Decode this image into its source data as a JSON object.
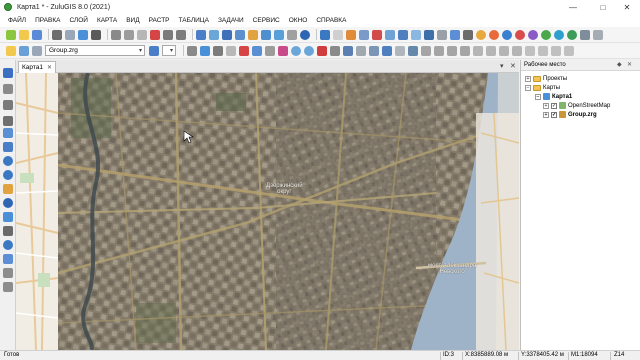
{
  "window": {
    "title": "Карта1 * - ZuluGIS 8.0 (2021)"
  },
  "menu": [
    "ФАЙЛ",
    "ПРАВКА",
    "СЛОЙ",
    "КАРТА",
    "ВИД",
    "РАСТР",
    "ТАБЛИЦА",
    "ЗАДАЧИ",
    "СЕРВИС",
    "ОКНО",
    "СПРАВКА"
  ],
  "toolbar": {
    "layer_combo": "Group.zrg"
  },
  "tabs": [
    {
      "label": "Карта1"
    }
  ],
  "map": {
    "labels": [
      {
        "text": "Дзержинский",
        "sub": "округ"
      },
      {
        "text": "мост Александра",
        "sub": "Невского"
      }
    ]
  },
  "workspace": {
    "title": "Рабочее место",
    "tree": [
      {
        "label": "Проекты"
      },
      {
        "label": "Карты"
      },
      {
        "label": "Карта1"
      },
      {
        "label": "OpenStreetMap"
      },
      {
        "label": "Group.zrg"
      }
    ]
  },
  "status": {
    "ready": "Готов",
    "id": "ID:3",
    "x": "X:8385889.08 м",
    "y": "Y:3378405.42 м",
    "scale": "M1:18094",
    "zoom": "Z14"
  }
}
